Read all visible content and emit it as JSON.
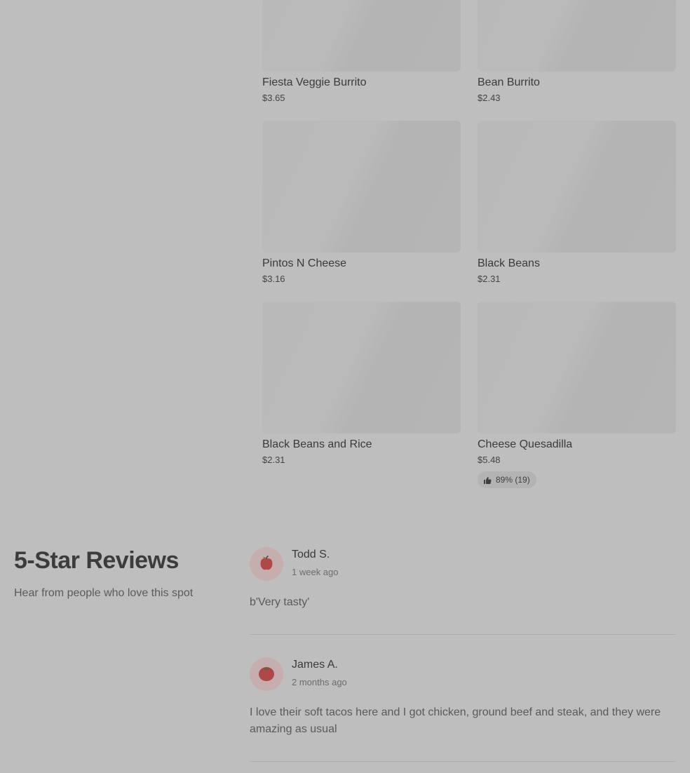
{
  "menu": {
    "items": [
      {
        "name": "Fiesta Veggie Burrito",
        "price": "$3.65"
      },
      {
        "name": "Bean Burrito",
        "price": "$2.43"
      },
      {
        "name": "Pintos N Cheese",
        "price": "$3.16"
      },
      {
        "name": "Black Beans",
        "price": "$2.31"
      },
      {
        "name": "Black Beans and Rice",
        "price": "$2.31"
      },
      {
        "name": "Cheese Quesadilla",
        "price": "$5.48",
        "rating": "89% (19)"
      }
    ]
  },
  "reviews": {
    "title": "5-Star Reviews",
    "subtitle": "Hear from people who love this spot",
    "list": [
      {
        "name": "Todd S.",
        "time": "1 week ago",
        "text": "b'Very tasty'",
        "avatar_icon": "apple-icon"
      },
      {
        "name": "James A.",
        "time": "2 months ago",
        "text": "I love their soft tacos here and I got chicken, ground beef and steak, and they were amazing as usual",
        "avatar_icon": "tomato-icon"
      }
    ]
  },
  "colors": {
    "overlay_background": "#bebebe",
    "avatar_background": "#c6aeae",
    "icon_red": "#b04848"
  }
}
